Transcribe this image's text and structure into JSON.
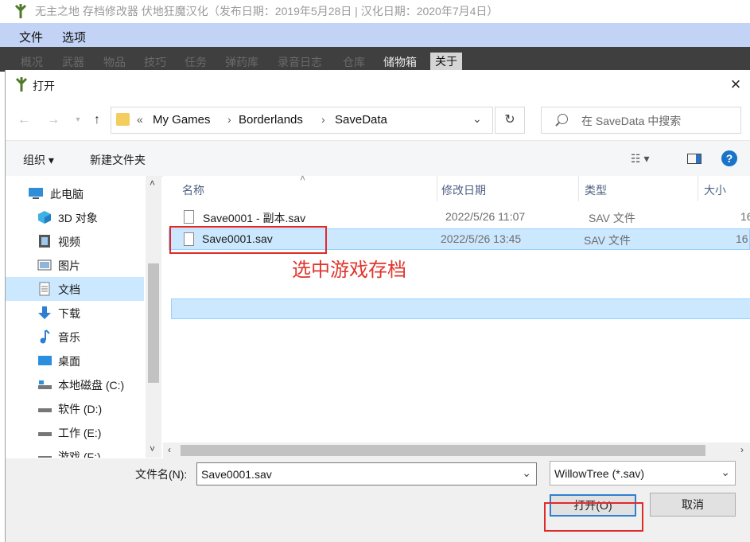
{
  "app": {
    "title": "无主之地 存档修改器 伏地狂魔汉化（发布日期：2019年5月28日 | 汉化日期：2020年7月4日）",
    "menu": [
      "文件",
      "选项"
    ],
    "tabs": [
      "概况",
      "武器",
      "物品",
      "技巧",
      "任务",
      "弹药库",
      "录音日志",
      "仓库",
      "储物箱",
      "关于"
    ],
    "selected_tab": "关于"
  },
  "dialog": {
    "title": "打开",
    "address": {
      "prefix": "«",
      "crumbs": [
        "My Games",
        "Borderlands",
        "SaveData"
      ]
    },
    "search_placeholder": "在 SaveData 中搜索",
    "toolbar": {
      "organize": "组织",
      "new_folder": "新建文件夹",
      "help": "?"
    },
    "nav": [
      {
        "label": "此电脑",
        "icon": "pc-icon"
      },
      {
        "label": "3D 对象",
        "icon": "cube-icon"
      },
      {
        "label": "视频",
        "icon": "video-icon"
      },
      {
        "label": "图片",
        "icon": "picture-icon"
      },
      {
        "label": "文档",
        "icon": "document-icon"
      },
      {
        "label": "下载",
        "icon": "download-icon"
      },
      {
        "label": "音乐",
        "icon": "music-icon"
      },
      {
        "label": "桌面",
        "icon": "desktop-icon"
      },
      {
        "label": "本地磁盘 (C:)",
        "icon": "disk-icon"
      },
      {
        "label": "软件 (D:)",
        "icon": "drive-icon"
      },
      {
        "label": "工作 (E:)",
        "icon": "drive-icon"
      },
      {
        "label": "游戏 (F:)",
        "icon": "drive-icon"
      }
    ],
    "selected_nav": "文档",
    "columns": [
      "名称",
      "修改日期",
      "类型",
      "大小"
    ],
    "files": [
      {
        "name": "Save0001 - 副本.sav",
        "date": "2022/5/26 11:07",
        "type": "SAV 文件",
        "size": "16"
      },
      {
        "name": "Save0001.sav",
        "date": "2022/5/26 13:45",
        "type": "SAV 文件",
        "size": "16"
      }
    ],
    "selected_file": "Save0001.sav",
    "filename_label": "文件名(N):",
    "filename_value": "Save0001.sav",
    "filter": "WillowTree (*.sav)",
    "open_button": "打开(O)",
    "cancel_button": "取消"
  },
  "annotation": "选中游戏存档",
  "colors": {
    "annotation": "#e02a2a",
    "selection": "#cce8ff",
    "menubar": "#c3d3f5",
    "tabbar": "#3f3f3f",
    "help": "#1a73c9"
  }
}
